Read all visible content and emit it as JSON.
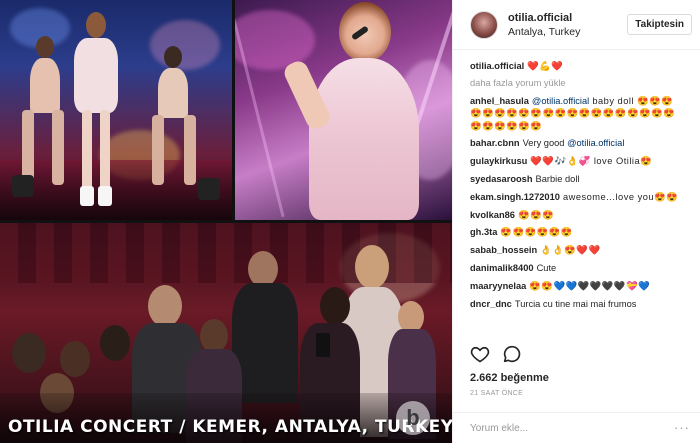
{
  "photo": {
    "caption": "OTILIA CONCERT / KEMER, ANTALYA, TURKEY",
    "watermark": "b"
  },
  "post": {
    "username": "otilia.official",
    "location": "Antalya, Turkey",
    "follow_label": "Takiptesin",
    "caption_user": "otilia.official",
    "caption_text": "❤️💪❤️",
    "load_more": "daha fazla yorum yükle",
    "comments": [
      {
        "user": "anhel_hasula",
        "mention": "@otilia.official",
        "text": " baby doll 😍😍😍😍😍😍😍😍😍😍😍😍😍😍😍😍😍😍😍😍😍😍😍😍😍😍"
      },
      {
        "user": "bahar.cbnn",
        "text": "Very good ",
        "mention": "@otilia.official"
      },
      {
        "user": "gulaykirkusu",
        "text": "❤️❤️🎶👌💞 love Otilia😍"
      },
      {
        "user": "syedasaroosh",
        "text": "Barbie doll"
      },
      {
        "user": "ekam.singh.1272010",
        "text": "awesome...love you😍😍"
      },
      {
        "user": "kvolkan86",
        "text": "😍😍😍"
      },
      {
        "user": "gh.3ta",
        "text": "😍😍😍😍😍😍"
      },
      {
        "user": "sabab_hossein",
        "text": "👌👌😍❤️❤️"
      },
      {
        "user": "danimalik8400",
        "text": "Cute"
      },
      {
        "user": "maaryynelaa",
        "text": "😍😍💙💙🖤🖤🖤🖤💝💙"
      },
      {
        "user": "dncr_dnc",
        "text": "Turcia cu tine mai mai frumos"
      }
    ],
    "likes": "2.662 beğenme",
    "time": "21 SAAT ÖNCE",
    "comment_placeholder": "Yorum ekle...",
    "more_dots": "···"
  },
  "icons": {
    "like": "heart-outline-icon",
    "comment": "speech-bubble-icon",
    "more": "more-dots-icon"
  }
}
